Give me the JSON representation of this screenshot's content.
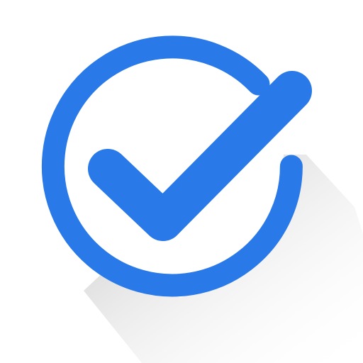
{
  "icon": {
    "name": "check-circle-icon",
    "colors": {
      "background": "#ffffff",
      "stroke": "#2979e8",
      "shadow_start": "#b5b5b5",
      "shadow_end": "#ffffff"
    }
  }
}
